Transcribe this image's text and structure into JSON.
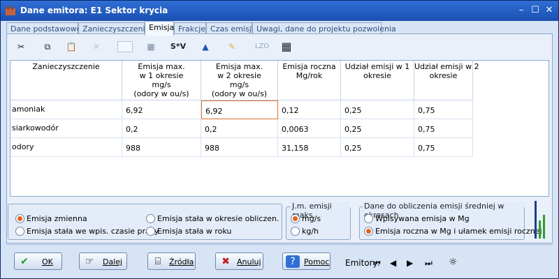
{
  "window": {
    "title": "Dane emitora: E1 Sektor krycia",
    "minimize": "–",
    "restore": "☐",
    "close": "✕"
  },
  "tabs": [
    "Dane podstawowe",
    "Zanieczyszczenia",
    "Emisja",
    "Frakcje",
    "Czas emisji",
    "Uwagi, dane do projektu pozwolenia"
  ],
  "toolbar": {
    "s_v": "S*V",
    "lzo": "LZO"
  },
  "table": {
    "headers": [
      "Zanieczyszczenie",
      "Emisja max.\nw 1 okresie\nmg/s\n(odory w ou/s)",
      "Emisja max.\nw 2 okresie\nmg/s\n(odory w ou/s)",
      "Emisja roczna\nMg/rok",
      "Udział emisji w 1\nokresie",
      "Udział emisji w 2\nokresie"
    ],
    "rows": [
      [
        "amoniak",
        "6,92",
        "6,92",
        "0,12",
        "0,25",
        "0,75"
      ],
      [
        "siarkowodór",
        "0,2",
        "0,2",
        "0,0063",
        "0,25",
        "0,75"
      ],
      [
        "odory",
        "988",
        "988",
        "31,158",
        "0,25",
        "0,75"
      ]
    ]
  },
  "emission_type": {
    "emisja_zmienna": "Emisja zmienna",
    "emisja_stala_wpis": "Emisja stała we wpis. czasie pracy",
    "emisja_stala_okres": "Emisja stała w okresie obliczen.",
    "emisja_stala_roku": "Emisja stała w roku"
  },
  "unit_group": {
    "legend": "J.m. emisji maks.",
    "mg_s": "mg/s",
    "kg_h": "kg/h"
  },
  "avg_group": {
    "legend": "Dane do obliczenia emisji średniej w okresach",
    "opt1": "Wpisywana emisja w Mg",
    "opt2": "Emisja roczna w Mg i ułamek emisji rocznej"
  },
  "buttons": {
    "ok": "OK",
    "dalej": "Dalej",
    "zrodla": "Źródła",
    "anuluj": "Anuluj",
    "pomoc": "Pomoc"
  },
  "emitory_label": "Emitory:",
  "colors": {
    "accent": "#e2641f",
    "title_bar": "#1a4fb0"
  }
}
